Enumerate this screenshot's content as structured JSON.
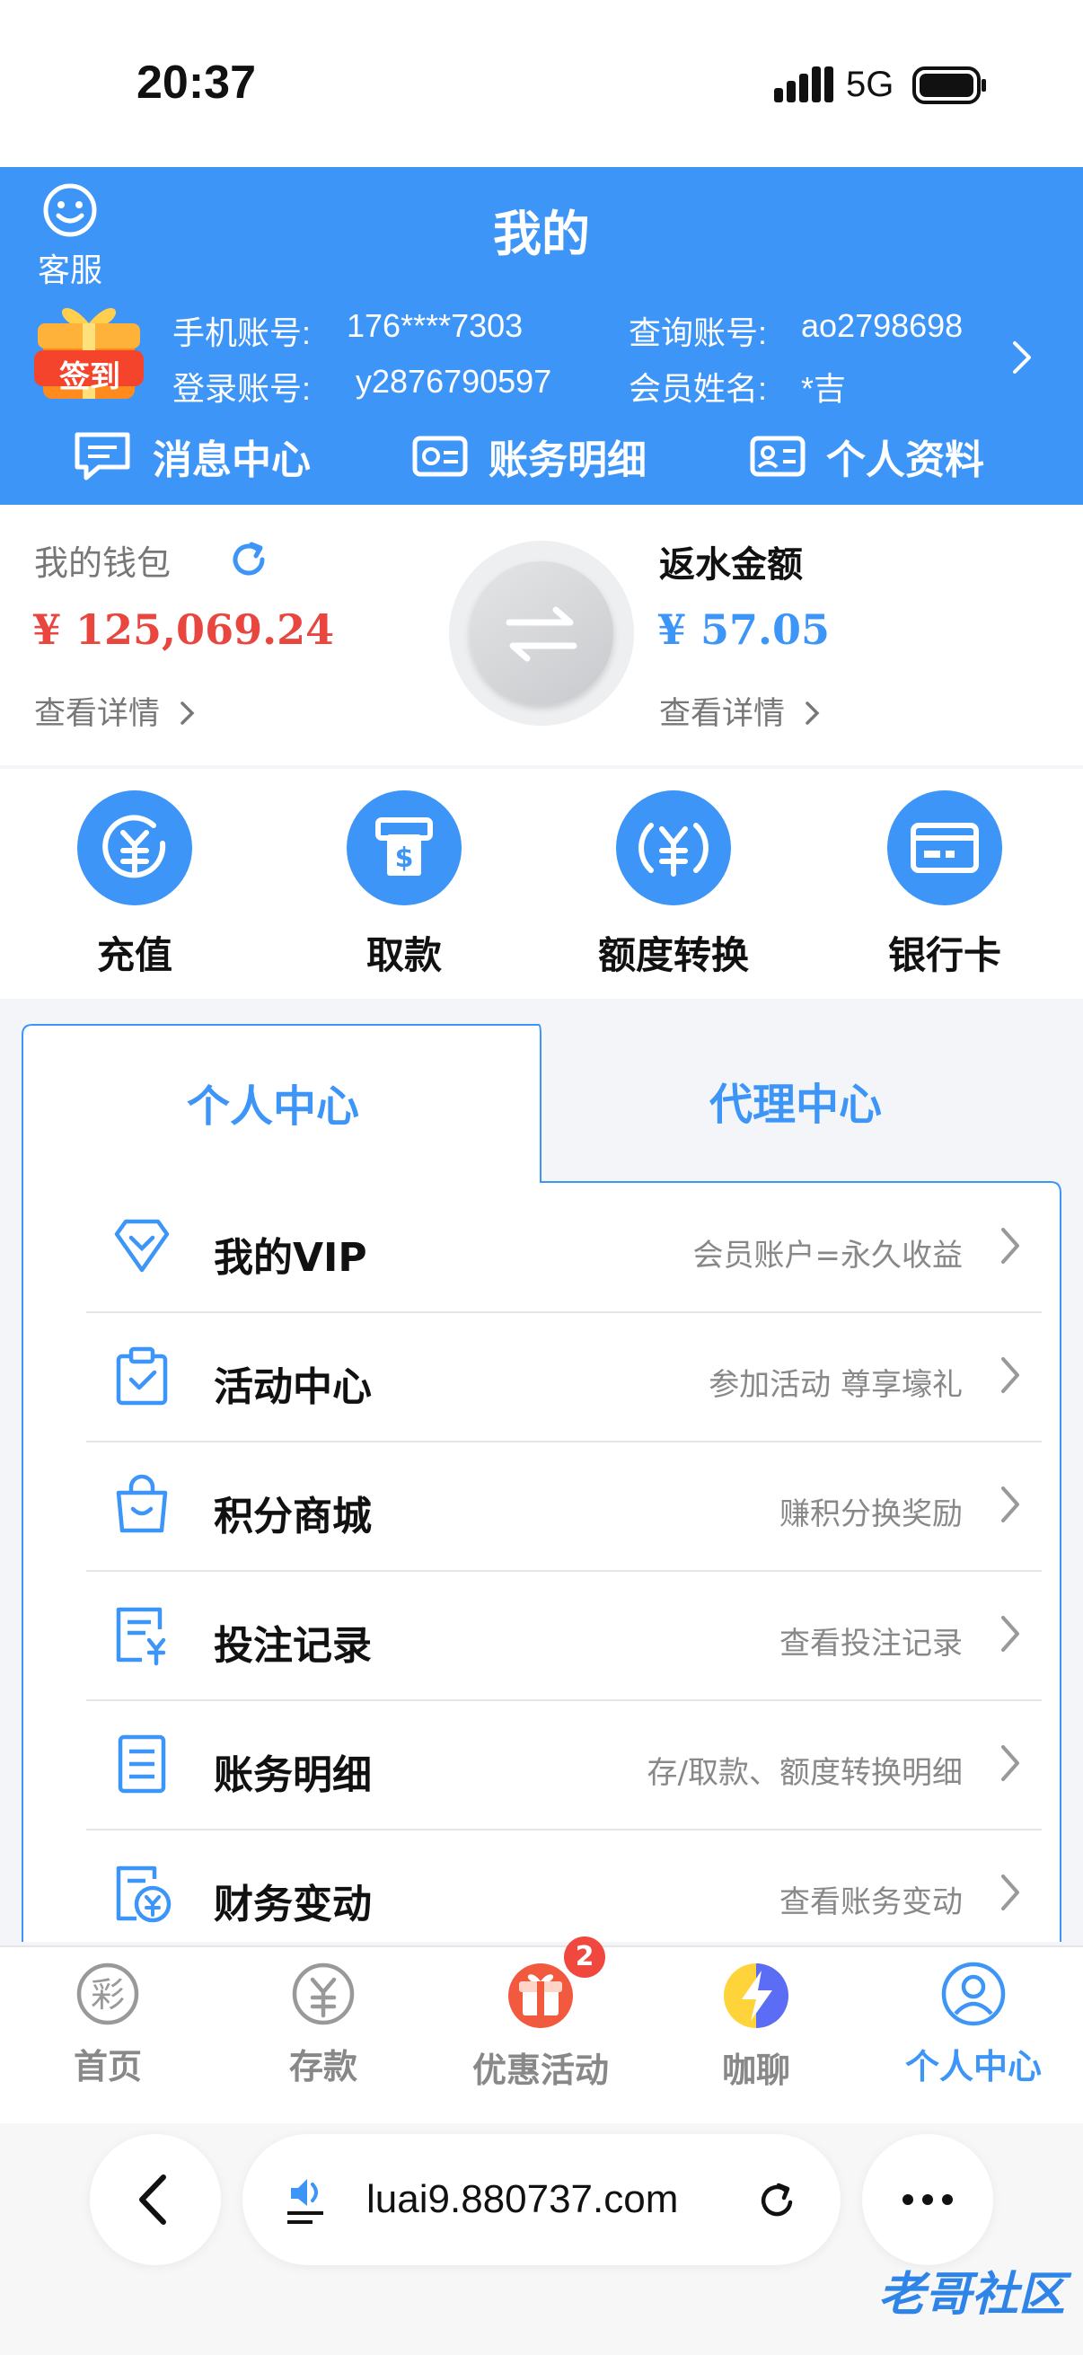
{
  "status_bar": {
    "time": "20:37",
    "network": "5G"
  },
  "header": {
    "title": "我的",
    "service_label": "客服",
    "checkin_label": "签到",
    "account": {
      "phone_label": "手机账号:",
      "phone_value": "176****7303",
      "query_label": "查询账号:",
      "query_value": "ao2798698",
      "login_label": "登录账号:",
      "login_value": "y2876790597",
      "name_label": "会员姓名:",
      "name_value": "*吉"
    },
    "quick_nav": [
      {
        "label": "消息中心",
        "icon": "message-icon"
      },
      {
        "label": "账务明细",
        "icon": "ledger-icon"
      },
      {
        "label": "个人资料",
        "icon": "profile-card-icon"
      }
    ]
  },
  "wallet": {
    "title": "我的钱包",
    "amount": "¥ 125,069.24",
    "detail_label": "查看详情",
    "rebate_title": "返水金额",
    "rebate_amount": "¥ 57.05",
    "rebate_detail_label": "查看详情",
    "colors": {
      "amount": "#e8463e",
      "rebate": "#3d95f7"
    }
  },
  "actions": [
    {
      "label": "充值",
      "icon": "deposit-yuan-icon"
    },
    {
      "label": "取款",
      "icon": "withdraw-atm-icon"
    },
    {
      "label": "额度转换",
      "icon": "transfer-yuan-icon"
    },
    {
      "label": "银行卡",
      "icon": "bank-card-icon"
    }
  ],
  "tabs": {
    "personal": "个人中心",
    "agent": "代理中心"
  },
  "menu": [
    {
      "title": "我的VIP",
      "subtitle": "会员账户=永久收益",
      "icon": "diamond-icon"
    },
    {
      "title": "活动中心",
      "subtitle": "参加活动 尊享壕礼",
      "icon": "clipboard-check-icon"
    },
    {
      "title": "积分商城",
      "subtitle": "赚积分换奖励",
      "icon": "shopping-bag-icon"
    },
    {
      "title": "投注记录",
      "subtitle": "查看投注记录",
      "icon": "bet-record-icon"
    },
    {
      "title": "账务明细",
      "subtitle": "存/取款、额度转换明细",
      "icon": "list-doc-icon"
    },
    {
      "title": "财务变动",
      "subtitle": "查看账务变动",
      "icon": "finance-doc-icon"
    }
  ],
  "bottom_nav": [
    {
      "label": "首页",
      "icon": "lottery-icon"
    },
    {
      "label": "存款",
      "icon": "yuan-icon"
    },
    {
      "label": "优惠活动",
      "icon": "gift-icon",
      "badge": "2"
    },
    {
      "label": "咖聊",
      "icon": "lightning-icon"
    },
    {
      "label": "个人中心",
      "icon": "user-icon"
    }
  ],
  "browser": {
    "url": "luai9.880737.com"
  },
  "watermark": "老哥社区",
  "accent_color": "#3d95f7"
}
